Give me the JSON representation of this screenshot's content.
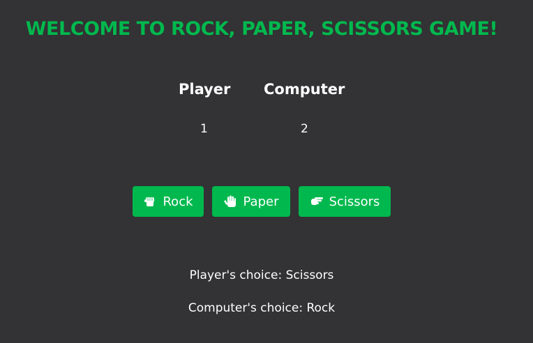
{
  "title": "WELCOME TO ROCK, PAPER, SCISSORS GAME!",
  "scoreboard": {
    "player_label": "Player",
    "computer_label": "Computer",
    "player_score": "1",
    "computer_score": "2"
  },
  "buttons": [
    {
      "label": "Rock",
      "icon": "hand-rock-icon"
    },
    {
      "label": "Paper",
      "icon": "hand-paper-icon"
    },
    {
      "label": "Scissors",
      "icon": "hand-scissors-icon"
    }
  ],
  "results": {
    "player_choice": "Player's choice: Scissors",
    "computer_choice": "Computer's choice: Rock"
  },
  "colors": {
    "background": "#333234",
    "accent": "#00b84e",
    "text": "#ffffff"
  }
}
